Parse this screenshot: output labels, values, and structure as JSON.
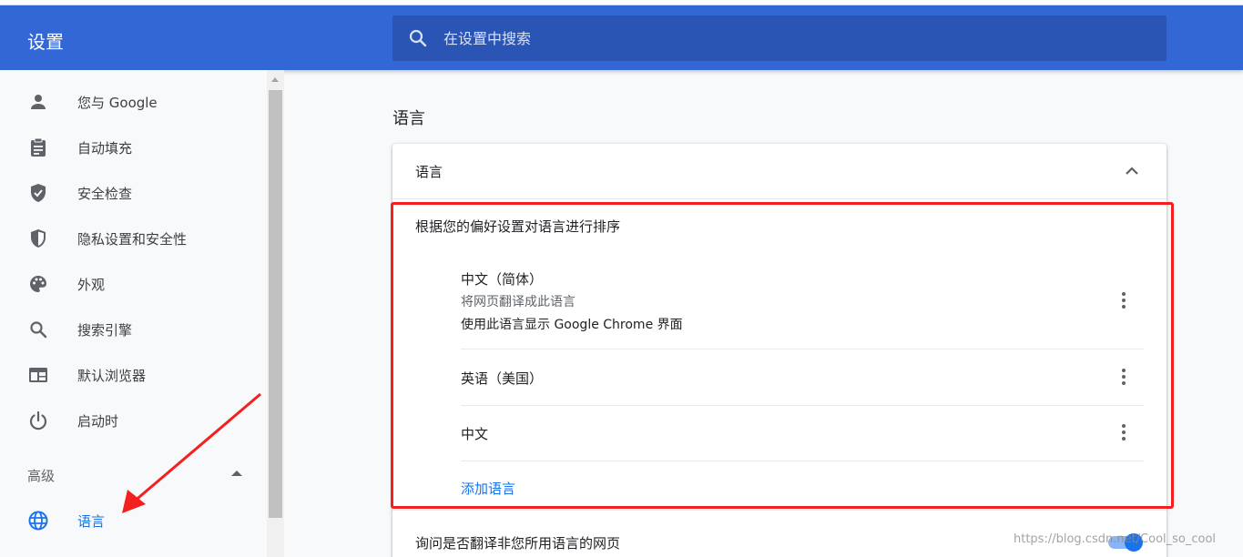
{
  "header": {
    "title": "设置",
    "search_placeholder": "在设置中搜索"
  },
  "sidebar": {
    "items": [
      {
        "label": "您与 Google",
        "icon": "person-icon"
      },
      {
        "label": "自动填充",
        "icon": "clipboard-icon"
      },
      {
        "label": "安全检查",
        "icon": "shield-check-icon"
      },
      {
        "label": "隐私设置和安全性",
        "icon": "shield-icon"
      },
      {
        "label": "外观",
        "icon": "palette-icon"
      },
      {
        "label": "搜索引擎",
        "icon": "search-icon"
      },
      {
        "label": "默认浏览器",
        "icon": "browser-window-icon"
      },
      {
        "label": "启动时",
        "icon": "power-icon"
      }
    ],
    "advanced_label": "高级",
    "active_item": {
      "label": "语言",
      "icon": "globe-icon"
    }
  },
  "main": {
    "section_title": "语言",
    "card": {
      "header_label": "语言",
      "order_description": "根据您的偏好设置对语言进行排序",
      "languages": [
        {
          "name": "中文（简体）",
          "sub1": "将网页翻译成此语言",
          "sub2": "使用此语言显示 Google Chrome 界面"
        },
        {
          "name": "英语（美国）"
        },
        {
          "name": "中文"
        }
      ],
      "add_language": "添加语言",
      "ask_translate": "询问是否翻译非您所用语言的网页"
    }
  },
  "watermark": "https://blog.csdn.net/Cool_so_cool",
  "colors": {
    "header": "#3367d6",
    "accent": "#1a73e8",
    "annotation": "#f42020"
  }
}
